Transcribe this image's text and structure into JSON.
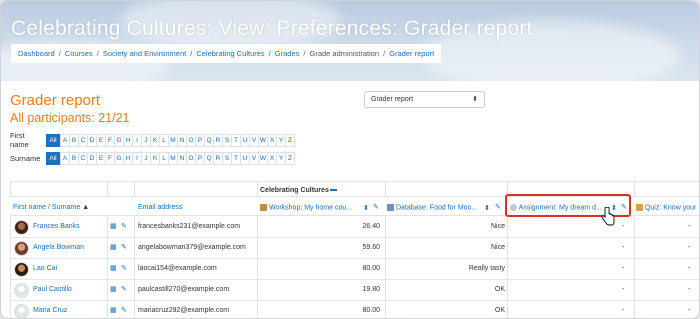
{
  "page": {
    "heading": "Celebrating Cultures: View: Preferences: Grader report",
    "breadcrumb": [
      "Dashboard",
      "Courses",
      "Society and Environment",
      "Celebrating Cultures",
      "Grades",
      "Grade administration",
      "Grader report"
    ],
    "breadcrumb_current_index": 5
  },
  "report": {
    "title": "Grader report",
    "participants": "All participants: 21/21",
    "selector_value": "Grader report"
  },
  "filters": {
    "first_name_label": "First name",
    "surname_label": "Surname",
    "all_label": "All",
    "letters": [
      "A",
      "B",
      "C",
      "D",
      "E",
      "F",
      "G",
      "H",
      "I",
      "J",
      "K",
      "L",
      "M",
      "N",
      "O",
      "P",
      "Q",
      "R",
      "S",
      "T",
      "U",
      "V",
      "W",
      "X",
      "Y",
      "Z"
    ]
  },
  "grid": {
    "category": "Celebrating Cultures",
    "columns": {
      "name": "First name / Surname",
      "email": "Email address",
      "workshop": "Workshop: My home cou...",
      "database": "Database: Food for Moo...",
      "assignment": "Assignment: My dream d...",
      "quiz": "Quiz: Know your"
    },
    "rows": [
      {
        "name": "Frances Banks",
        "email": "francesbanks231@example.com",
        "workshop": "26.40",
        "database": "Nice",
        "assignment": "-",
        "quiz": "-",
        "avatar": "photo-1"
      },
      {
        "name": "Angela Bowman",
        "email": "angelabowman379@example.com",
        "workshop": "59.60",
        "database": "Nice",
        "assignment": "-",
        "quiz": "-",
        "avatar": "photo-2"
      },
      {
        "name": "Lao Cai",
        "email": "laocai154@example.com",
        "workshop": "80.00",
        "database": "Really tasty",
        "assignment": "-",
        "quiz": "-",
        "avatar": "photo-3"
      },
      {
        "name": "Paul Castillo",
        "email": "paulcastill270@example.com",
        "workshop": "19.80",
        "database": "OK",
        "assignment": "-",
        "quiz": "-",
        "avatar": "default"
      },
      {
        "name": "Maria Cruz",
        "email": "mariacruz292@example.com",
        "workshop": "80.00",
        "database": "OK",
        "assignment": "-",
        "quiz": "-",
        "avatar": "default"
      }
    ]
  },
  "colors": {
    "accent_orange": "#e67e22",
    "link_blue": "#1a6fb5",
    "highlight_red": "#d9302a"
  }
}
